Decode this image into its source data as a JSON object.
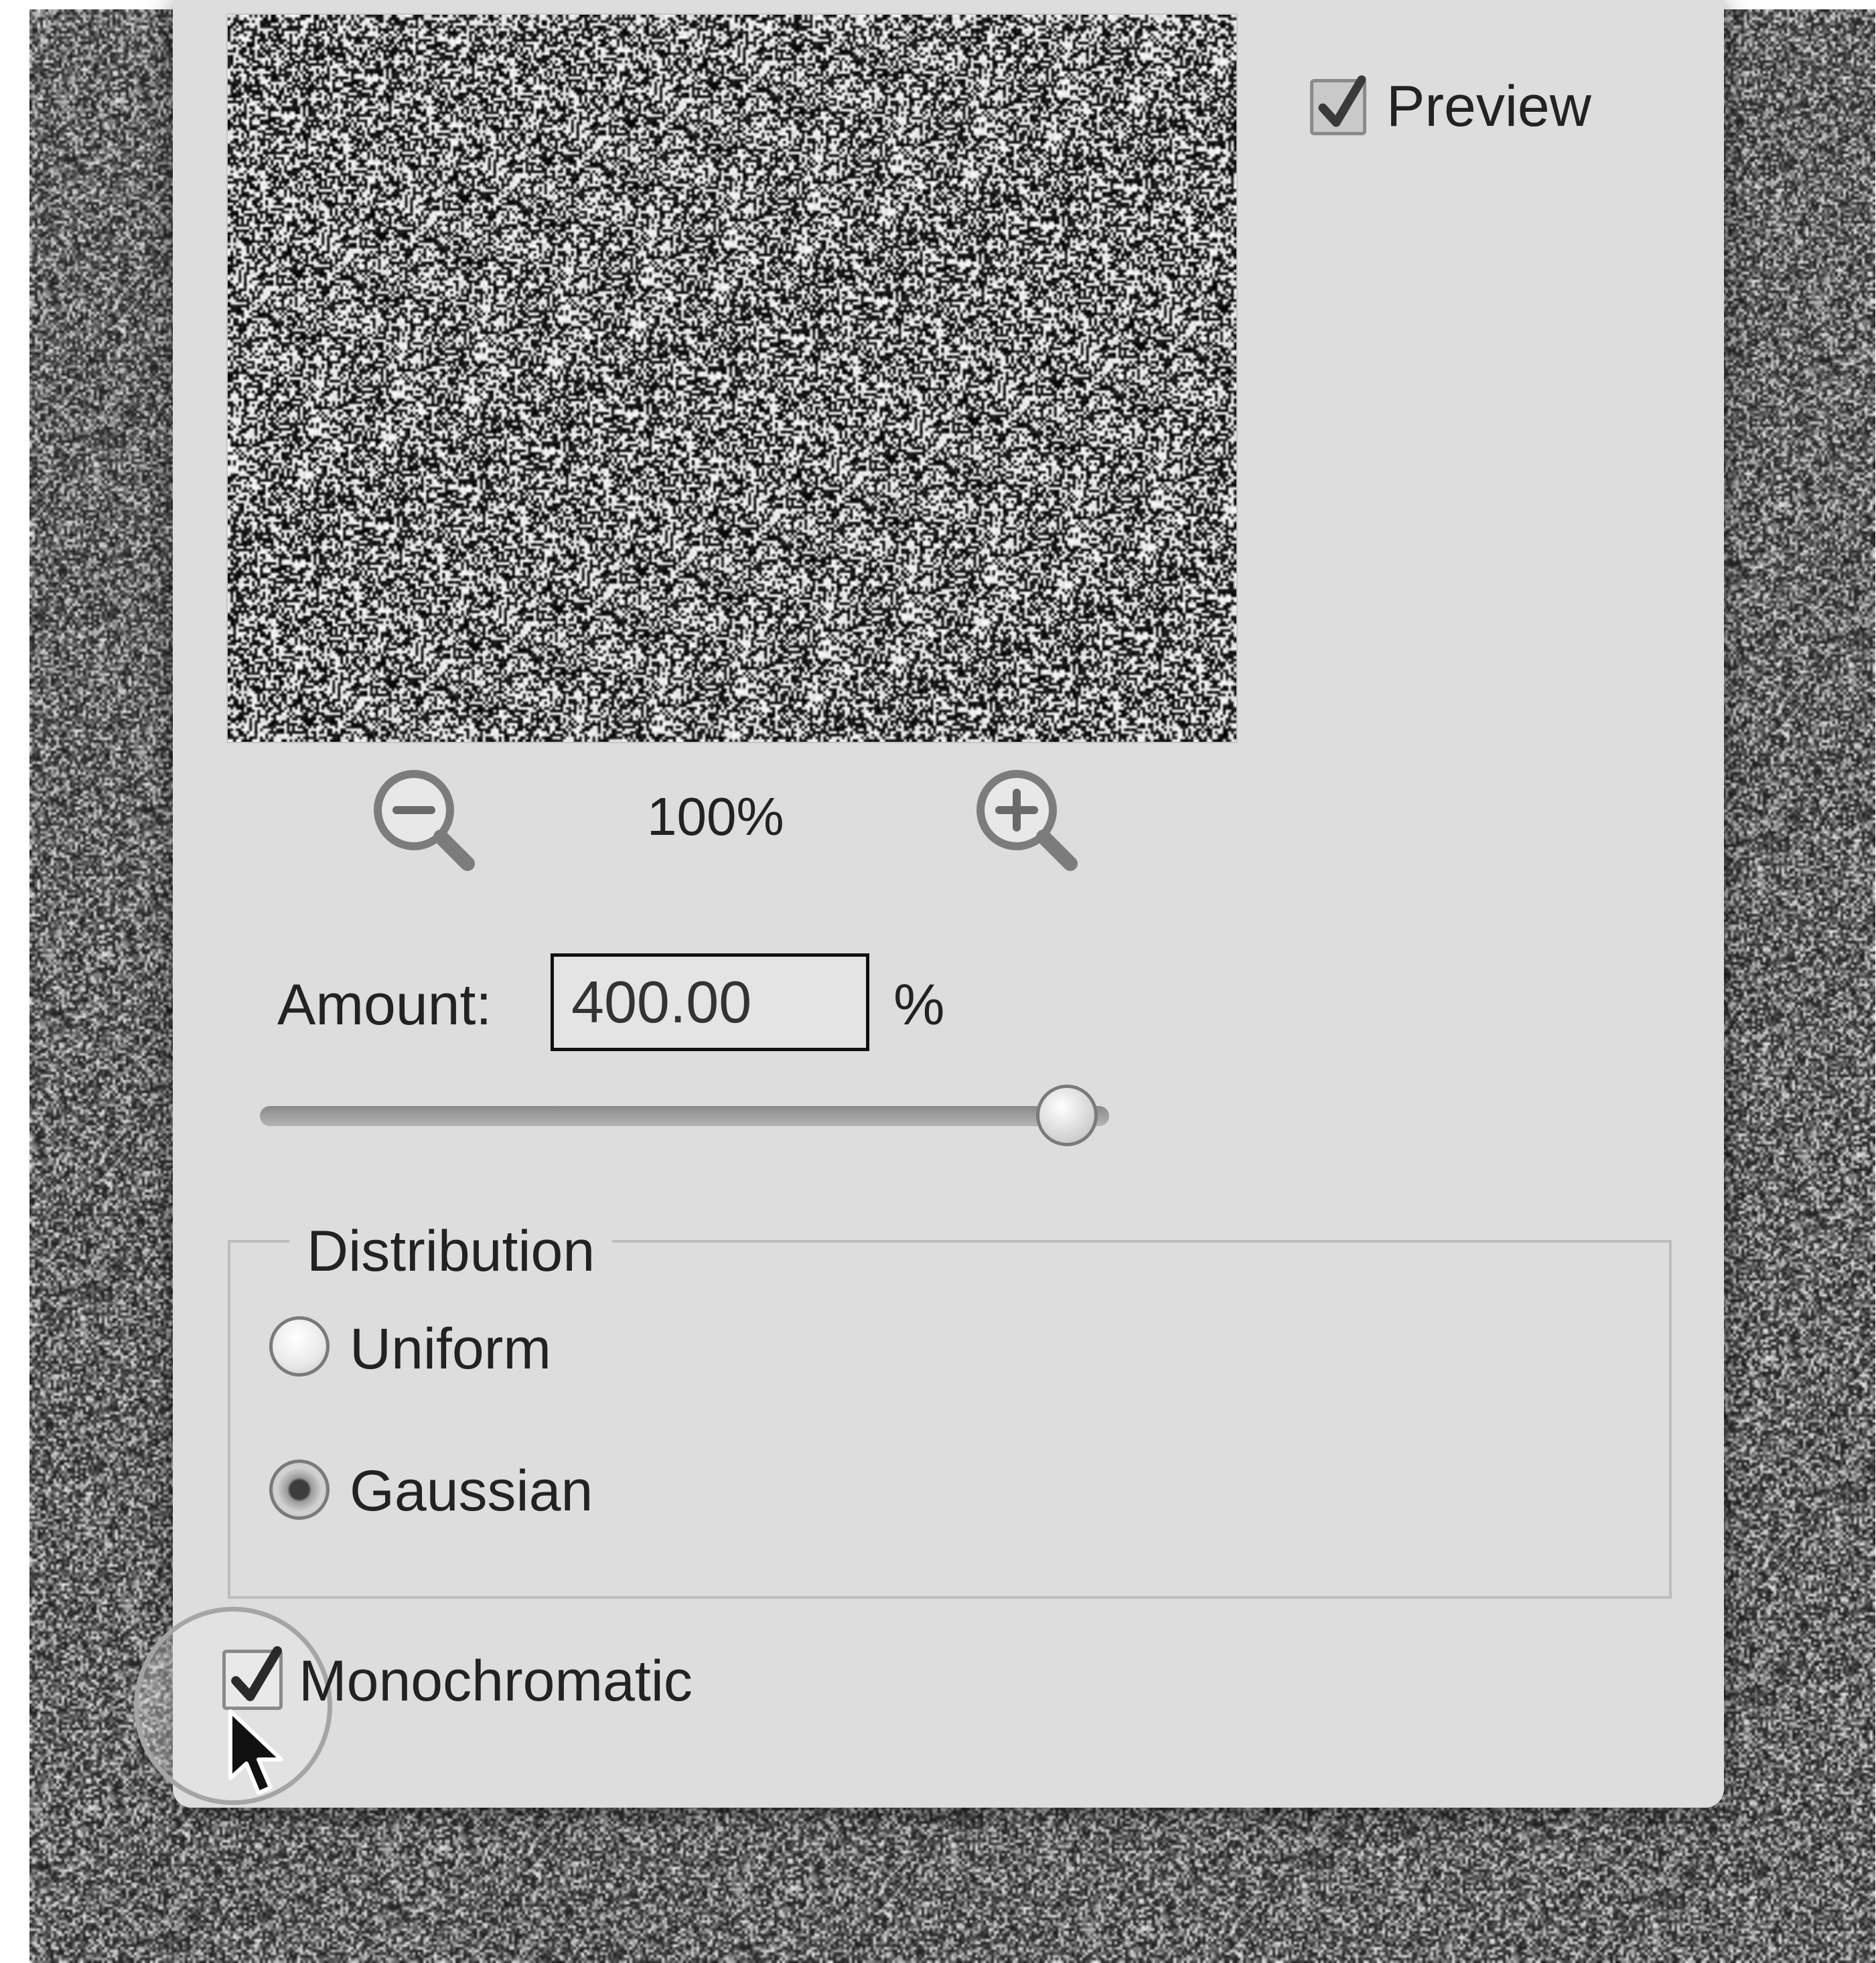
{
  "preview": {
    "label": "Preview",
    "checked": true
  },
  "zoom": {
    "value": "100%"
  },
  "amount": {
    "label": "Amount:",
    "value": "400.00",
    "unit": "%",
    "slider_fraction": 0.95
  },
  "distribution": {
    "legend": "Distribution",
    "options": [
      {
        "label": "Uniform",
        "selected": false
      },
      {
        "label": "Gaussian",
        "selected": true
      }
    ]
  },
  "monochromatic": {
    "label": "Monochromatic",
    "checked": true
  }
}
